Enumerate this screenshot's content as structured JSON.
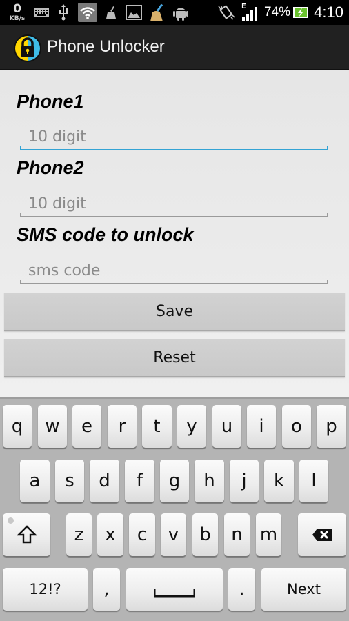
{
  "status_bar": {
    "net_speed_value": "0",
    "net_speed_unit": "KB/s",
    "notification_icons": [
      "keyboard-icon",
      "usb-icon",
      "wifi-icon",
      "cleaner-icon",
      "image-icon",
      "broom-icon",
      "android-icon"
    ],
    "system_icons": [
      "rotate-icon",
      "signal-icon",
      "battery-icon"
    ],
    "network_type": "E",
    "battery_percent": "74%",
    "time": "4:10"
  },
  "app_bar": {
    "title": "Phone Unlocker",
    "icon": "lock-icon",
    "icon_colors": {
      "left": "#ffd600",
      "right": "#3fbde8"
    }
  },
  "form": {
    "phone1": {
      "label": "Phone1",
      "placeholder": "10 digit",
      "value": "",
      "focused": true
    },
    "phone2": {
      "label": "Phone2",
      "placeholder": "10 digit",
      "value": ""
    },
    "sms_code": {
      "label": "SMS code to unlock",
      "placeholder": "sms code",
      "value": ""
    },
    "save_label": "Save",
    "reset_label": "Reset",
    "accent_color": "#33a3d4"
  },
  "keyboard": {
    "row1": [
      "q",
      "w",
      "e",
      "r",
      "t",
      "y",
      "u",
      "i",
      "o",
      "p"
    ],
    "row2": [
      "a",
      "s",
      "d",
      "f",
      "g",
      "h",
      "j",
      "k",
      "l"
    ],
    "row3": [
      "z",
      "x",
      "c",
      "v",
      "b",
      "n",
      "m"
    ],
    "shift_icon": "shift-icon",
    "backspace_icon": "backspace-icon",
    "symbols_label": "12!?",
    "comma_label": ",",
    "space_icon": "space-icon",
    "period_label": ".",
    "action_label": "Next"
  }
}
